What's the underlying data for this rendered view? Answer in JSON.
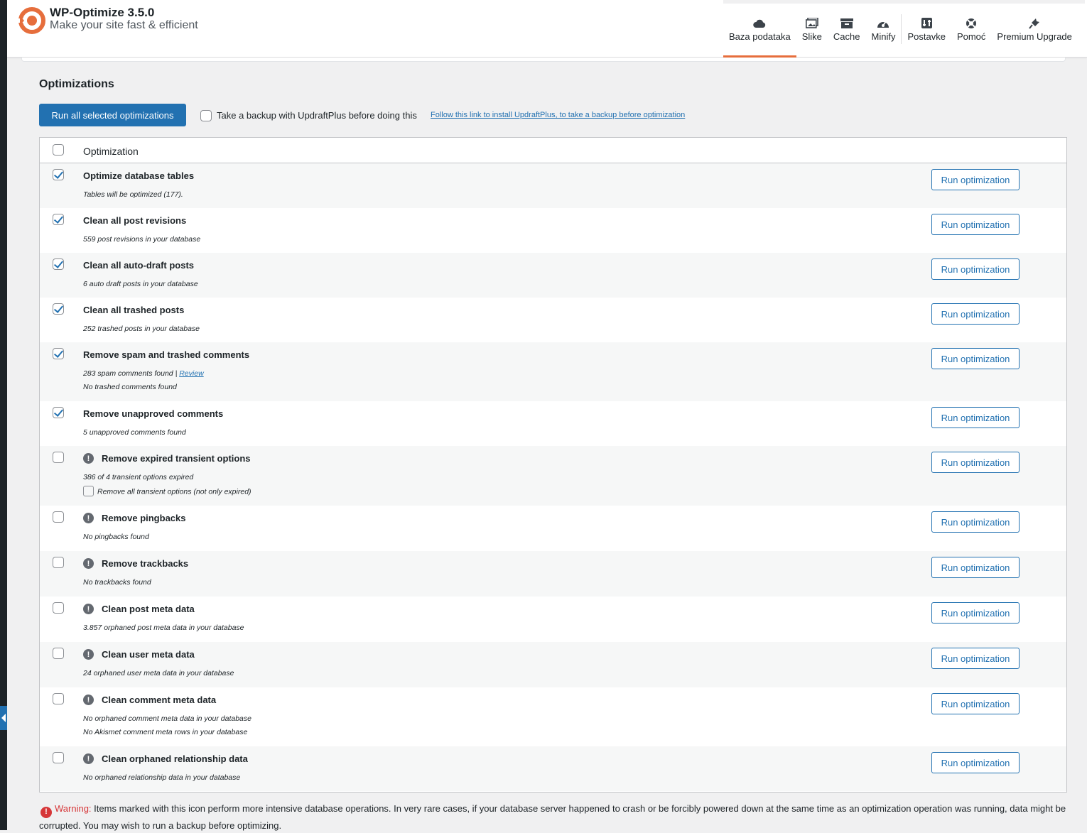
{
  "app": {
    "title": "WP-Optimize 3.5.0",
    "tagline": "Make your site fast & efficient"
  },
  "nav": [
    {
      "label": "Baza podataka",
      "icon": "cloud-icon",
      "active": true
    },
    {
      "label": "Slike",
      "icon": "images-icon"
    },
    {
      "label": "Cache",
      "icon": "archive-icon"
    },
    {
      "label": "Minify",
      "icon": "dashboard-icon"
    },
    {
      "label": "Postavke",
      "icon": "settings-icon"
    },
    {
      "label": "Pomoć",
      "icon": "lifesaver-icon"
    },
    {
      "label": "Premium Upgrade",
      "icon": "plugin-icon"
    }
  ],
  "section_title": "Optimizations",
  "run_all_label": "Run all selected optimizations",
  "backup": {
    "label": "Take a backup with UpdraftPlus before doing this",
    "link": "Follow this link to install UpdraftPlus, to take a backup before optimization"
  },
  "table_header": "Optimization",
  "run_label": "Run optimization",
  "rows": [
    {
      "title": "Optimize database tables",
      "checked": true,
      "warn": false,
      "lines": [
        "Tables will be optimized (177)."
      ]
    },
    {
      "title": "Clean all post revisions",
      "checked": true,
      "warn": false,
      "lines": [
        "559 post revisions in your database"
      ]
    },
    {
      "title": "Clean all auto-draft posts",
      "checked": true,
      "warn": false,
      "lines": [
        "6 auto draft posts in your database"
      ]
    },
    {
      "title": "Clean all trashed posts",
      "checked": true,
      "warn": false,
      "lines": [
        "252 trashed posts in your database"
      ]
    },
    {
      "title": "Remove spam and trashed comments",
      "checked": true,
      "warn": false,
      "lines": [
        "283 spam comments found | ",
        "No trashed comments found"
      ],
      "link": "Review"
    },
    {
      "title": "Remove unapproved comments",
      "checked": true,
      "warn": false,
      "lines": [
        "5 unapproved comments found"
      ]
    },
    {
      "title": "Remove expired transient options",
      "checked": false,
      "warn": true,
      "lines": [
        "386 of 4 transient options expired",
        "Remove all transient options (not only expired)"
      ],
      "subcheck": true
    },
    {
      "title": "Remove pingbacks",
      "checked": false,
      "warn": true,
      "lines": [
        "No pingbacks found"
      ]
    },
    {
      "title": "Remove trackbacks",
      "checked": false,
      "warn": true,
      "lines": [
        "No trackbacks found"
      ]
    },
    {
      "title": "Clean post meta data",
      "checked": false,
      "warn": true,
      "lines": [
        "3.857 orphaned post meta data in your database"
      ]
    },
    {
      "title": "Clean user meta data",
      "checked": false,
      "warn": true,
      "lines": [
        "24 orphaned user meta data in your database"
      ]
    },
    {
      "title": "Clean comment meta data",
      "checked": false,
      "warn": true,
      "lines": [
        "No orphaned comment meta data in your database",
        "No Akismet comment meta rows in your database"
      ]
    },
    {
      "title": "Clean orphaned relationship data",
      "checked": false,
      "warn": true,
      "lines": [
        "No orphaned relationship data in your database"
      ]
    }
  ],
  "warning": {
    "label": "Warning:",
    "text": "Items marked with this icon perform more intensive database operations. In very rare cases, if your database server happened to crash or be forcibly powered down at the same time as an optimization operation was running, data might be corrupted. You may wish to run a backup before optimizing."
  },
  "colors": {
    "accent": "#e66e3c",
    "primary": "#2271b1",
    "warning": "#d63638"
  }
}
